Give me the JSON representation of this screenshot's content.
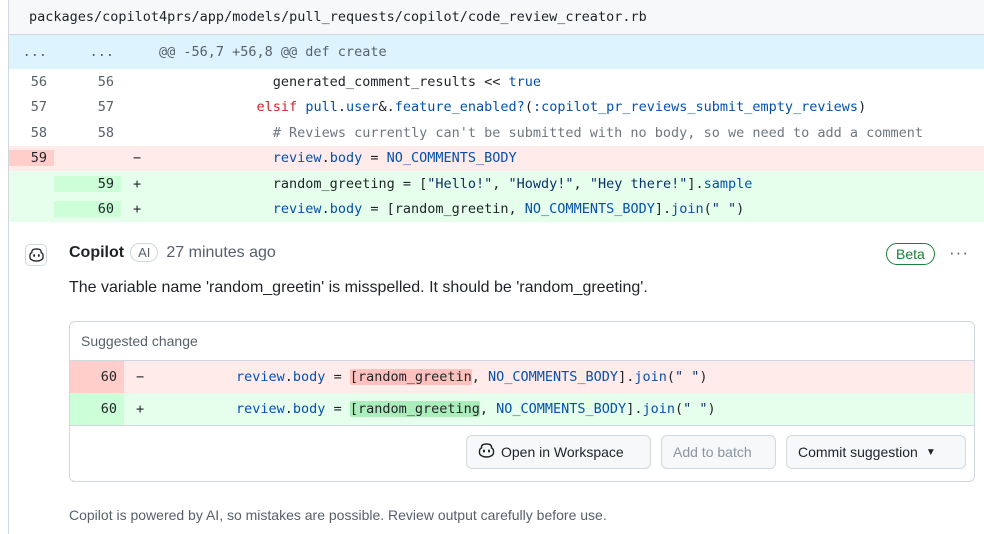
{
  "file": {
    "path": "packages/copilot4prs/app/models/pull_requests/copilot/code_review_creator.rb"
  },
  "hunk": {
    "old_dots": "...",
    "new_dots": "...",
    "header": "@@ -56,7 +56,8 @@ def create"
  },
  "diff": {
    "l56": {
      "old": "56",
      "new": "56"
    },
    "l57": {
      "old": "57",
      "new": "57"
    },
    "l58": {
      "old": "58",
      "new": "58",
      "comment": "# Reviews currently can't be submitted with no body, so we need to add a comment"
    },
    "l59del": {
      "old": "59",
      "sign": "−"
    },
    "l59add": {
      "new": "59",
      "sign": "+"
    },
    "l60add": {
      "new": "60",
      "sign": "+"
    }
  },
  "comment": {
    "author": "Copilot",
    "badge": "AI",
    "time": "27 minutes ago",
    "beta": "Beta",
    "menu": "···",
    "body": "The variable name 'random_greetin' is misspelled. It should be 'random_greeting'.",
    "avatar_icon": "copilot-icon"
  },
  "suggestion": {
    "title": "Suggested change",
    "del": {
      "num": "60",
      "sign": "−"
    },
    "add": {
      "num": "60",
      "sign": "+"
    }
  },
  "buttons": {
    "open_workspace": "Open in Workspace",
    "add_to_batch": "Add to batch",
    "commit": "Commit suggestion"
  },
  "footer": "Copilot is powered by AI, so mistakes are possible. Review output carefully before use.",
  "colors": {
    "deletion_bg": "#ffebe9",
    "addition_bg": "#e6ffec",
    "hunk_bg": "#ddf4ff",
    "beta": "#1a7f37"
  }
}
